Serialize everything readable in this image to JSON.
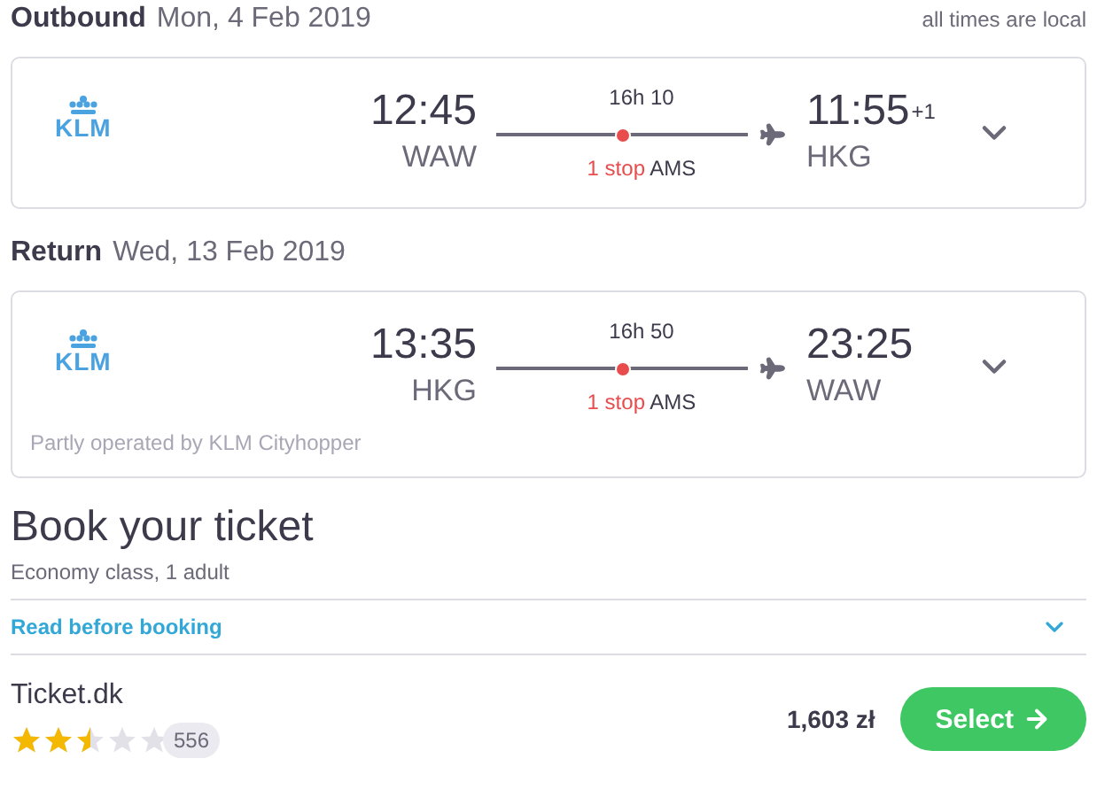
{
  "legs": [
    {
      "label": "Outbound",
      "date": "Mon, 4 Feb 2019",
      "note": "all times are local",
      "airline": "KLM",
      "depart_time": "12:45",
      "depart_airport": "WAW",
      "duration": "16h 10",
      "stops": "1 stop",
      "stop_airport": "AMS",
      "arrive_time": "11:55",
      "day_offset": "+1",
      "arrive_airport": "HKG"
    },
    {
      "label": "Return",
      "date": "Wed, 13 Feb 2019",
      "airline": "KLM",
      "depart_time": "13:35",
      "depart_airport": "HKG",
      "duration": "16h 50",
      "stops": "1 stop",
      "stop_airport": "AMS",
      "arrive_time": "23:25",
      "arrive_airport": "WAW",
      "operated_by": "Partly operated by KLM Cityhopper"
    }
  ],
  "booking": {
    "title": "Book your ticket",
    "subtitle": "Economy class, 1 adult",
    "info_link": "Read before booking",
    "info_expanded": false,
    "offers": [
      {
        "provider": "Ticket.dk",
        "stars": 2.5,
        "reviews": "556",
        "price": "1,603 zł",
        "button": "Select"
      }
    ]
  }
}
